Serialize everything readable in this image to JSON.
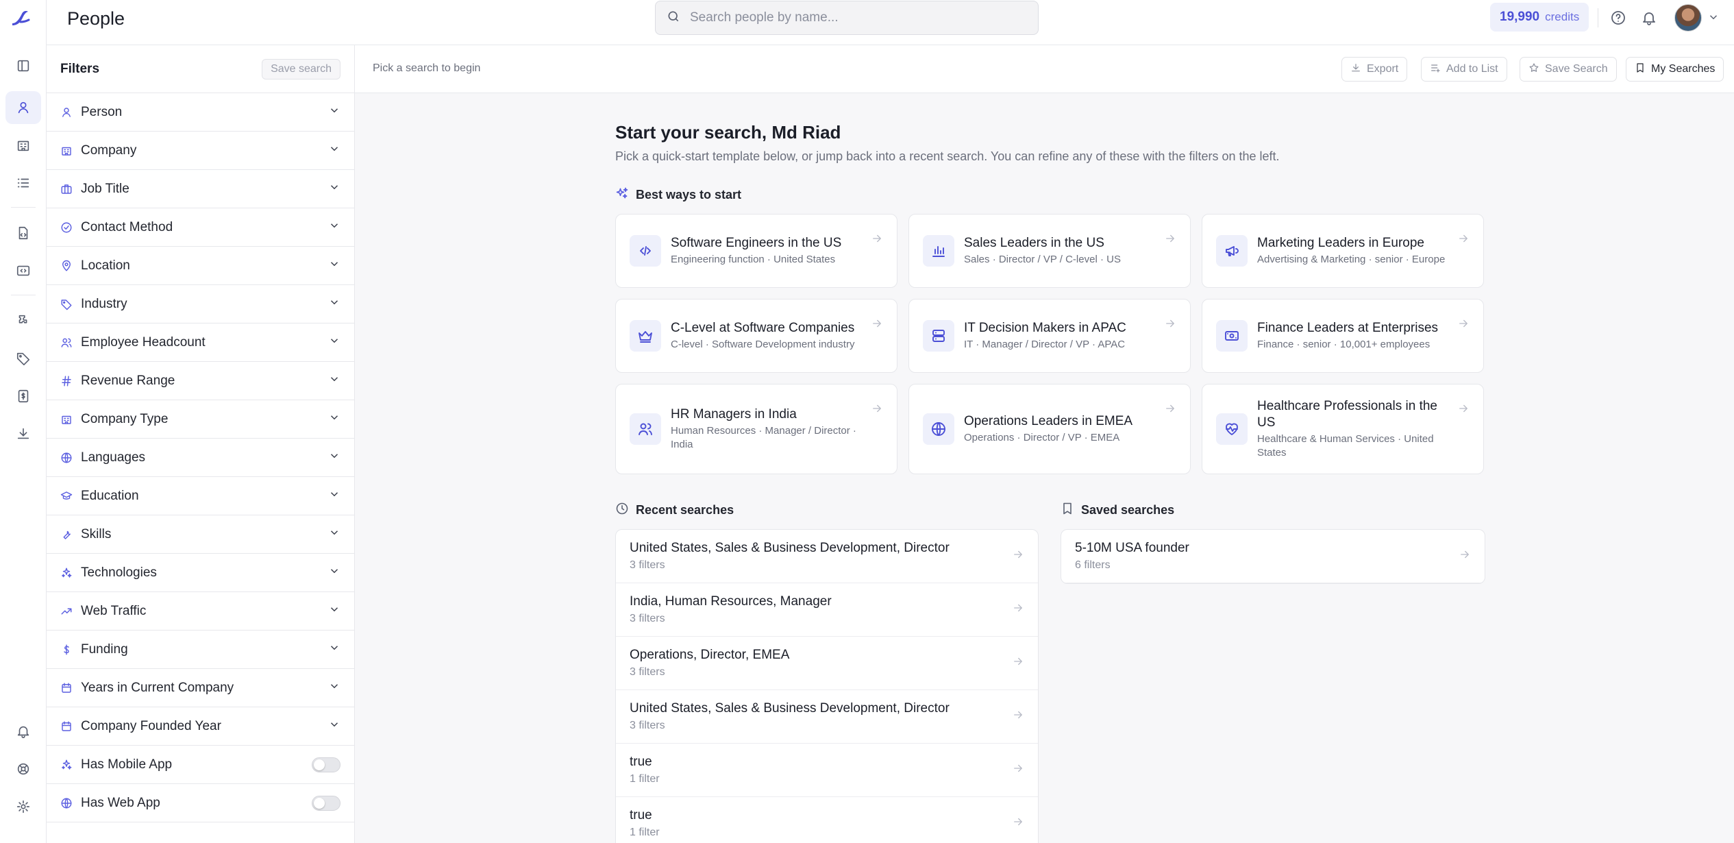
{
  "app": {
    "page_title": "People",
    "search_placeholder": "Search people by name...",
    "credits_value": "19,990",
    "credits_label": "credits"
  },
  "rail": {
    "icons": [
      "logo-icon",
      "panel-icon",
      "person-icon",
      "building-icon",
      "list-icon",
      "document-code-icon",
      "code-icon",
      "puzzle-icon",
      "tag-icon",
      "dollar-doc-icon",
      "download-icon",
      "bell-icon",
      "lifebuoy-icon",
      "gear-icon"
    ]
  },
  "filters": {
    "title": "Filters",
    "save_label": "Save search",
    "items": [
      {
        "label": "Person",
        "icon": "person-icon"
      },
      {
        "label": "Company",
        "icon": "building-icon"
      },
      {
        "label": "Job Title",
        "icon": "briefcase-icon"
      },
      {
        "label": "Contact Method",
        "icon": "check-circle-icon"
      },
      {
        "label": "Location",
        "icon": "pin-icon"
      },
      {
        "label": "Industry",
        "icon": "tag-icon"
      },
      {
        "label": "Employee Headcount",
        "icon": "users-icon"
      },
      {
        "label": "Revenue Range",
        "icon": "hash-icon"
      },
      {
        "label": "Company Type",
        "icon": "building-icon"
      },
      {
        "label": "Languages",
        "icon": "globe-icon"
      },
      {
        "label": "Education",
        "icon": "graduation-icon"
      },
      {
        "label": "Skills",
        "icon": "tool-icon"
      },
      {
        "label": "Technologies",
        "icon": "puzzle-icon"
      },
      {
        "label": "Web Traffic",
        "icon": "trend-icon"
      },
      {
        "label": "Funding",
        "icon": "dollar-icon"
      },
      {
        "label": "Years in Current Company",
        "icon": "calendar-icon"
      },
      {
        "label": "Company Founded Year",
        "icon": "calendar-icon"
      }
    ],
    "toggles": [
      {
        "label": "Has Mobile App",
        "icon": "puzzle-icon",
        "on": false
      },
      {
        "label": "Has Web App",
        "icon": "globe-icon",
        "on": false
      }
    ]
  },
  "toolbar": {
    "hint": "Pick a search to begin",
    "export": "Export",
    "add_to_list": "Add to List",
    "save_search": "Save Search",
    "my_searches": "My Searches"
  },
  "main": {
    "heading": "Start your search, Md Riad",
    "subheading": "Pick a quick-start template below, or jump back into a recent search. You can refine any of these with the filters on the left.",
    "best_title": "Best ways to start",
    "templates": [
      {
        "title": "Software Engineers in the US",
        "desc": "Engineering function · United States",
        "icon": "code-icon"
      },
      {
        "title": "Sales Leaders in the US",
        "desc": "Sales · Director / VP / C-level · US",
        "icon": "bar-chart-icon"
      },
      {
        "title": "Marketing Leaders in Europe",
        "desc": "Advertising & Marketing · senior · Europe",
        "icon": "megaphone-icon"
      },
      {
        "title": "C-Level at Software Companies",
        "desc": "C-level · Software Development industry",
        "icon": "crown-icon"
      },
      {
        "title": "IT Decision Makers in APAC",
        "desc": "IT · Manager / Director / VP · APAC",
        "icon": "server-icon"
      },
      {
        "title": "Finance Leaders at Enterprises",
        "desc": "Finance · senior · 10,001+ employees",
        "icon": "banknote-icon"
      },
      {
        "title": "HR Managers in India",
        "desc": "Human Resources · Manager / Director · India",
        "icon": "users-icon"
      },
      {
        "title": "Operations Leaders in EMEA",
        "desc": "Operations · Director / VP · EMEA",
        "icon": "globe-icon"
      },
      {
        "title": "Healthcare Professionals in the US",
        "desc": "Healthcare & Human Services · United States",
        "icon": "heart-pulse-icon"
      }
    ],
    "recent_title": "Recent searches",
    "recent": [
      {
        "title": "United States, Sales & Business Development, Director",
        "sub": "3 filters"
      },
      {
        "title": "India, Human Resources, Manager",
        "sub": "3 filters"
      },
      {
        "title": "Operations, Director, EMEA",
        "sub": "3 filters"
      },
      {
        "title": "United States, Sales & Business Development, Director",
        "sub": "3 filters"
      },
      {
        "title": "true",
        "sub": "1 filter"
      },
      {
        "title": "true",
        "sub": "1 filter"
      }
    ],
    "saved_title": "Saved searches",
    "saved": [
      {
        "title": "5-10M USA founder",
        "sub": "6 filters"
      }
    ]
  },
  "colors": {
    "accent": "#4b4fd6",
    "accent_bg": "#eef0fb",
    "border": "#e7e8ec"
  }
}
